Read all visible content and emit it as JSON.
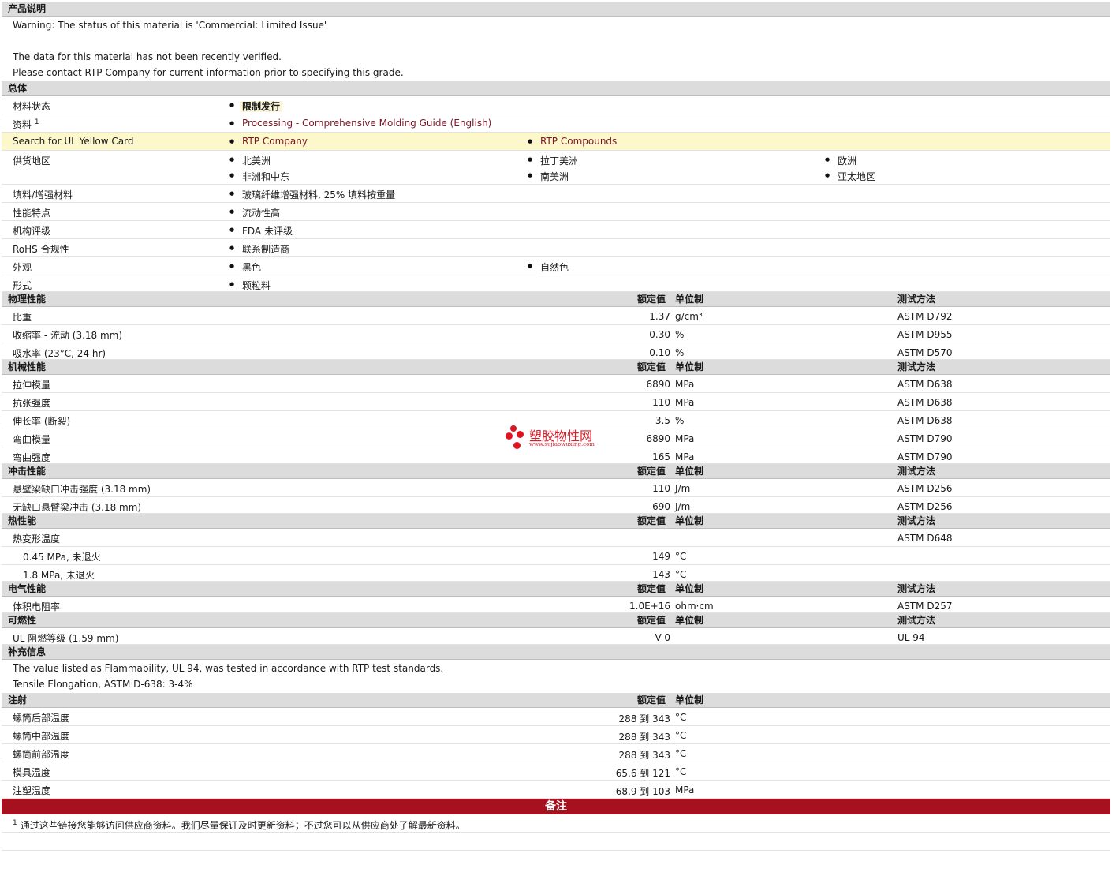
{
  "product": {
    "title": "产品说明",
    "lines": [
      "Warning: The status of this material is 'Commercial: Limited Issue'",
      "",
      "The data for this material has not been recently verified.",
      "Please contact RTP Company for current information prior to specifying this grade."
    ]
  },
  "general": {
    "title": "总体",
    "status_label": "材料状态",
    "status_value": "限制发行",
    "doc_label": "资料",
    "doc_sup": "1",
    "doc_link": "Processing - Comprehensive Molding Guide (English)",
    "ul_label": "Search for UL Yellow Card",
    "ul_link1": "RTP Company",
    "ul_link2": "RTP Compounds",
    "supply_label": "供货地区",
    "supply": [
      "北美洲",
      "拉丁美洲",
      "欧洲",
      "非洲和中东",
      "南美洲",
      "亚太地区"
    ],
    "filler_label": "填料/增强材料",
    "filler_value": "玻璃纤维增强材料, 25% 填料按重量",
    "feature_label": "性能特点",
    "feature_value": "流动性高",
    "agency_label": "机构评级",
    "agency_value": "FDA 未评级",
    "rohs_label": "RoHS 合规性",
    "rohs_value": "联系制造商",
    "appearance_label": "外观",
    "appearance": [
      "黑色",
      "自然色"
    ],
    "form_label": "形式",
    "form_value": "颗粒料"
  },
  "headers": {
    "value": "额定值",
    "unit": "单位制",
    "method": "测试方法"
  },
  "physical": {
    "title": "物理性能",
    "rows": [
      {
        "label": "比重",
        "value": "1.37",
        "unit": "g/cm³",
        "method": "ASTM D792"
      },
      {
        "label": "收缩率 - 流动 (3.18 mm)",
        "value": "0.30",
        "unit": "%",
        "method": "ASTM D955"
      },
      {
        "label": "吸水率 (23°C, 24 hr)",
        "value": "0.10",
        "unit": "%",
        "method": "ASTM D570"
      }
    ]
  },
  "mechanical": {
    "title": "机械性能",
    "rows": [
      {
        "label": "拉伸模量",
        "value": "6890",
        "unit": "MPa",
        "method": "ASTM D638"
      },
      {
        "label": "抗张强度",
        "value": "110",
        "unit": "MPa",
        "method": "ASTM D638"
      },
      {
        "label": "伸长率 (断裂)",
        "value": "3.5",
        "unit": "%",
        "method": "ASTM D638"
      },
      {
        "label": "弯曲模量",
        "value": "6890",
        "unit": "MPa",
        "method": "ASTM D790"
      },
      {
        "label": "弯曲强度",
        "value": "165",
        "unit": "MPa",
        "method": "ASTM D790"
      }
    ]
  },
  "impact": {
    "title": "冲击性能",
    "rows": [
      {
        "label": "悬壁梁缺口冲击强度 (3.18 mm)",
        "value": "110",
        "unit": "J/m",
        "method": "ASTM D256"
      },
      {
        "label": "无缺口悬臂梁冲击 (3.18 mm)",
        "value": "690",
        "unit": "J/m",
        "method": "ASTM D256"
      }
    ]
  },
  "thermal": {
    "title": "热性能",
    "hdt_label": "热变形温度",
    "hdt_method": "ASTM D648",
    "rows": [
      {
        "label": "0.45 MPa, 未退火",
        "value": "149",
        "unit": "°C"
      },
      {
        "label": "1.8 MPa, 未退火",
        "value": "143",
        "unit": "°C"
      }
    ]
  },
  "electrical": {
    "title": "电气性能",
    "rows": [
      {
        "label": "体积电阻率",
        "value": "1.0E+16",
        "unit": "ohm·cm",
        "method": "ASTM D257"
      }
    ]
  },
  "flammability": {
    "title": "可燃性",
    "rows": [
      {
        "label": "UL 阻燃等级 (1.59 mm)",
        "value": "V-0",
        "unit": "",
        "method": "UL 94"
      }
    ]
  },
  "supplementary": {
    "title": "补充信息",
    "lines": [
      "The value listed as Flammability, UL 94, was tested in accordance with RTP test standards.",
      "Tensile Elongation, ASTM D-638: 3-4%"
    ]
  },
  "injection": {
    "title": "注射",
    "rows": [
      {
        "label": "螺筒后部温度",
        "value": "288 到  343",
        "unit": "°C"
      },
      {
        "label": "螺筒中部温度",
        "value": "288 到  343",
        "unit": "°C"
      },
      {
        "label": "螺筒前部温度",
        "value": "288 到  343",
        "unit": "°C"
      },
      {
        "label": "模具温度",
        "value": "65.6 到  121",
        "unit": "°C"
      },
      {
        "label": "注塑温度",
        "value": "68.9 到  103",
        "unit": "MPa"
      }
    ]
  },
  "notes": {
    "title": "备注",
    "sup": "1",
    "text": "通过这些链接您能够访问供应商资料。我们尽量保证及时更新资料；不过您可以从供应商处了解最新资料。"
  },
  "watermark": {
    "title": "塑胶物性网",
    "url": "www.sujiaowuxing.com",
    "color": "#e0141e"
  },
  "colors": {
    "section_bg": "#dcdcdc",
    "link": "#7a1424",
    "notes_bar": "#a5111e",
    "highlight_row": "#fdf7cc"
  }
}
